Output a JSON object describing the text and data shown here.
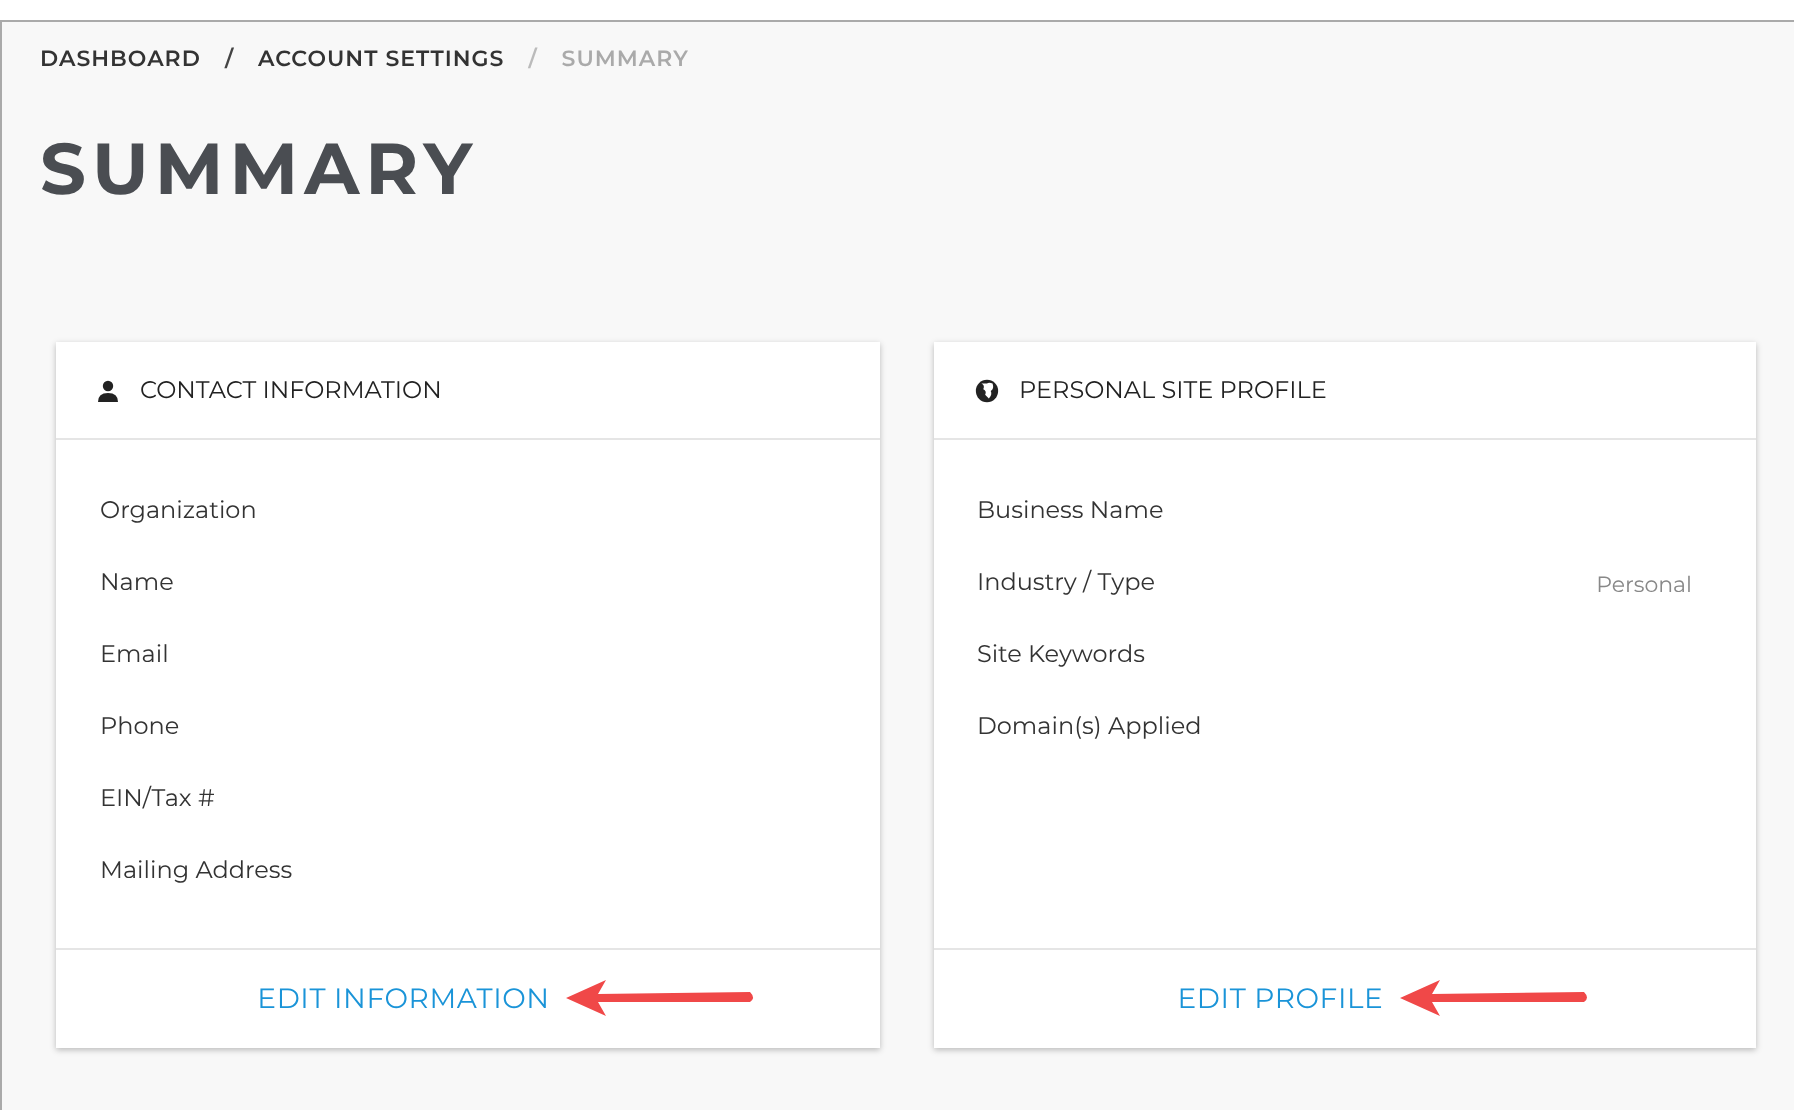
{
  "breadcrumb": [
    {
      "label": "DASHBOARD",
      "current": false
    },
    {
      "label": "ACCOUNT SETTINGS",
      "current": false
    },
    {
      "label": "SUMMARY",
      "current": true
    }
  ],
  "separator": "/",
  "title": "SUMMARY",
  "cards": [
    {
      "title": "CONTACT INFORMATION",
      "rows": [
        {
          "label": "Organization"
        },
        {
          "label": "Name"
        },
        {
          "label": "Email"
        },
        {
          "label": "Phone"
        },
        {
          "label": "EIN/Tax #"
        },
        {
          "label": "Mailing Address"
        }
      ],
      "action": "EDIT INFORMATION"
    },
    {
      "title": "PERSONAL SITE PROFILE",
      "rows": [
        {
          "label": "Business Name"
        },
        {
          "label": "Industry / Type",
          "value": "Personal"
        },
        {
          "label": "Site Keywords"
        },
        {
          "label": "Domain(s) Applied"
        }
      ],
      "action": "EDIT PROFILE"
    }
  ]
}
